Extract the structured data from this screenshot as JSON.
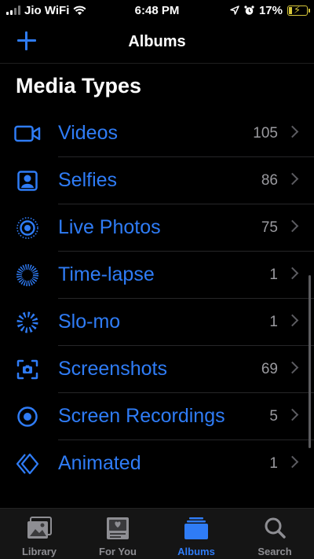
{
  "status_bar": {
    "carrier": "Jio WiFi",
    "time": "6:48 PM",
    "battery": "17%",
    "battery_level": 0.17,
    "icons": [
      "signal-icon",
      "wifi-icon",
      "location-icon",
      "alarm-icon",
      "battery-charging-icon"
    ]
  },
  "nav": {
    "title": "Albums",
    "add_icon": "plus-icon"
  },
  "section": {
    "title": "Media Types"
  },
  "albums": [
    {
      "label": "Videos",
      "count": "105",
      "icon": "video-icon"
    },
    {
      "label": "Selfies",
      "count": "86",
      "icon": "selfie-icon"
    },
    {
      "label": "Live Photos",
      "count": "75",
      "icon": "live-photo-icon"
    },
    {
      "label": "Time-lapse",
      "count": "1",
      "icon": "time-lapse-icon"
    },
    {
      "label": "Slo-mo",
      "count": "1",
      "icon": "slo-mo-icon"
    },
    {
      "label": "Screenshots",
      "count": "69",
      "icon": "screenshot-icon"
    },
    {
      "label": "Screen Recordings",
      "count": "5",
      "icon": "screen-recording-icon"
    },
    {
      "label": "Animated",
      "count": "1",
      "icon": "animated-icon"
    }
  ],
  "tabs": [
    {
      "label": "Library",
      "icon": "library-icon",
      "active": false
    },
    {
      "label": "For You",
      "icon": "for-you-icon",
      "active": false
    },
    {
      "label": "Albums",
      "icon": "albums-icon",
      "active": true
    },
    {
      "label": "Search",
      "icon": "search-icon",
      "active": false
    }
  ],
  "colors": {
    "accent": "#2f7cf6",
    "background": "#000000",
    "battery": "#d7c73a",
    "secondary_text": "#9a9a9f"
  }
}
